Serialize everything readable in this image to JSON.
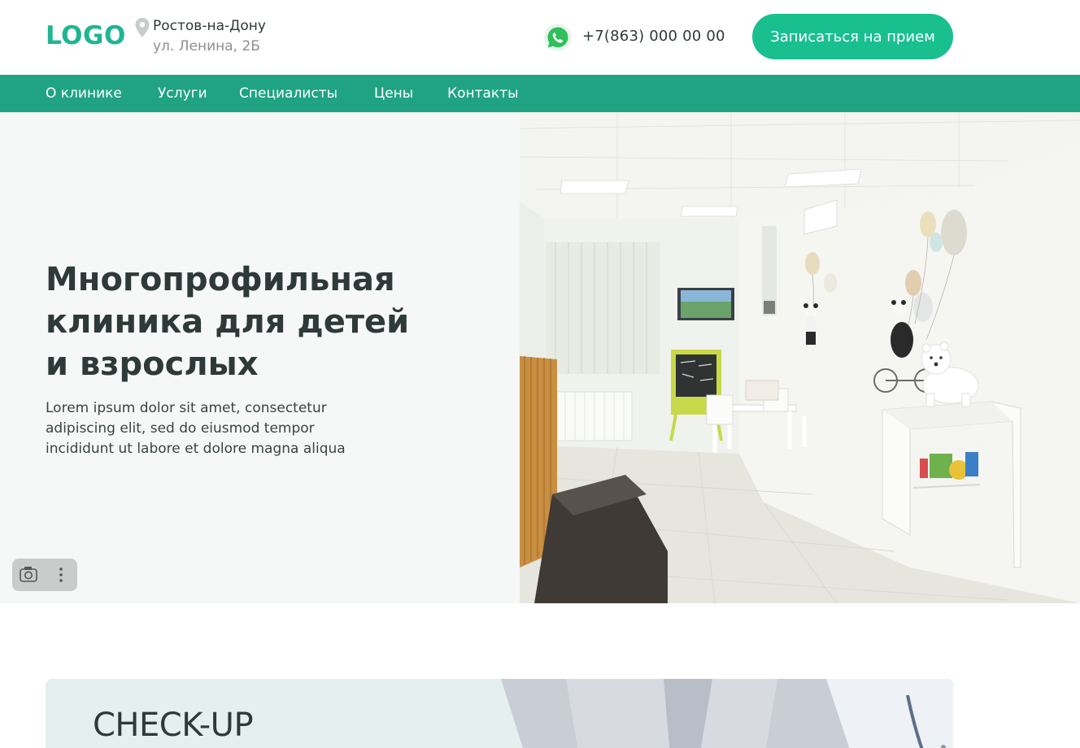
{
  "header": {
    "logo": "LOGO",
    "city": "Ростов-на-Дону",
    "street": "ул. Ленина, 2Б",
    "phone": "+7(863) 000 00 00",
    "cta_label": "Записаться на прием"
  },
  "nav": {
    "items": [
      {
        "label": "О клинике"
      },
      {
        "label": "Услуги"
      },
      {
        "label": "Специалисты"
      },
      {
        "label": "Цены"
      },
      {
        "label": "Контакты"
      }
    ]
  },
  "hero": {
    "title_lines": [
      "Многопрофильная",
      "клиника для детей",
      "и взрослых"
    ],
    "text_lines": [
      "Lorem ipsum dolor sit amet, consectetur",
      "adipiscing elit, sed do eiusmod tempor",
      "incididunt ut labore et dolore magna aliqua"
    ]
  },
  "checkup": {
    "title": "CHECK-UP"
  },
  "colors": {
    "brand": "#1fb592",
    "nav_bg": "#20a383",
    "cta_bg": "#19bf8f",
    "text": "#2e3a38",
    "muted": "#8b9190"
  },
  "icons": {
    "location": "location-pin-icon",
    "whatsapp": "whatsapp-icon",
    "camera": "camera-icon",
    "more": "more-vertical-icon"
  }
}
